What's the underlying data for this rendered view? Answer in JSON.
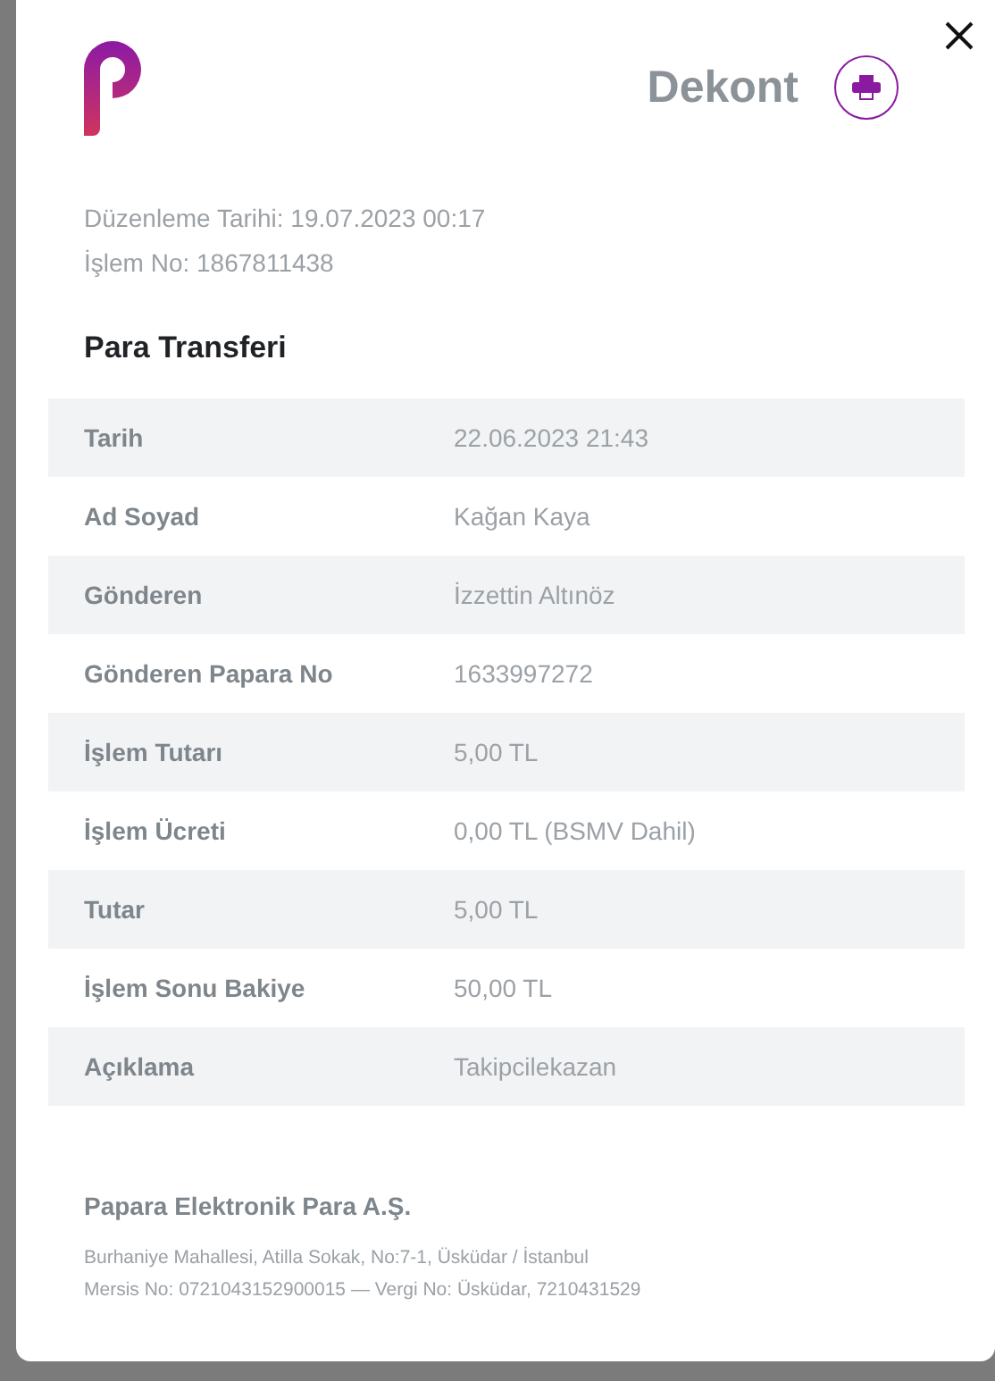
{
  "header": {
    "title": "Dekont"
  },
  "meta": [
    "Düzenleme Tarihi: 19.07.2023 00:17",
    "İşlem No: 1867811438"
  ],
  "section_title": "Para Transferi",
  "rows": [
    {
      "label": "Tarih",
      "value": "22.06.2023 21:43"
    },
    {
      "label": "Ad Soyad",
      "value": "Kağan Kaya"
    },
    {
      "label": "Gönderen",
      "value": "İzzettin Altınöz"
    },
    {
      "label": "Gönderen Papara No",
      "value": "1633997272"
    },
    {
      "label": "İşlem Tutarı",
      "value": "5,00 TL"
    },
    {
      "label": "İşlem Ücreti",
      "value": "0,00 TL (BSMV Dahil)"
    },
    {
      "label": "Tutar",
      "value": "5,00 TL"
    },
    {
      "label": "İşlem Sonu Bakiye",
      "value": "50,00 TL"
    },
    {
      "label": "Açıklama",
      "value": "Takipcilekazan"
    }
  ],
  "footer": {
    "company": "Papara Elektronik Para A.Ş.",
    "lines": [
      "Burhaniye Mahallesi, Atilla Sokak, No:7-1, Üsküdar / İstanbul",
      "Mersis No: 0721043152900015 — Vergi No: Üsküdar, 7210431529"
    ]
  }
}
